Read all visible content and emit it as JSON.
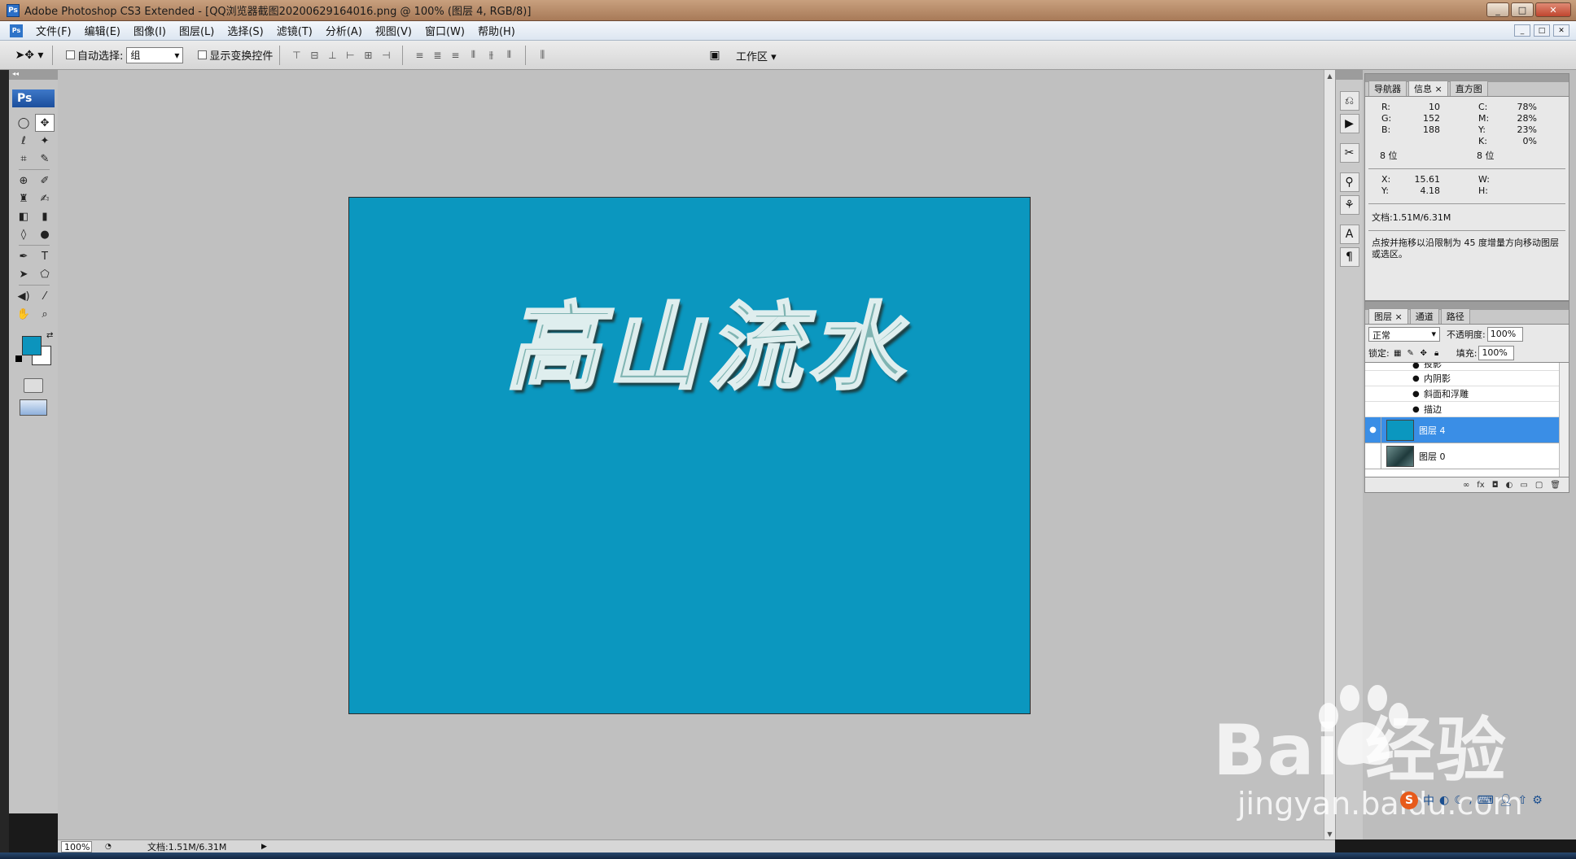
{
  "window": {
    "title": "Adobe Photoshop CS3 Extended - [QQ浏览器截图20200629164016.png @ 100% (图层 4, RGB/8)]",
    "app_icon": "Ps",
    "buttons": [
      "_",
      "□",
      "✕"
    ]
  },
  "menu": {
    "items": [
      "文件(F)",
      "编辑(E)",
      "图像(I)",
      "图层(L)",
      "选择(S)",
      "滤镜(T)",
      "分析(A)",
      "视图(V)",
      "窗口(W)",
      "帮助(H)"
    ],
    "mdi_buttons": [
      "_",
      "□",
      "✕"
    ]
  },
  "options": {
    "auto_select_label": "自动选择:",
    "auto_select_value": "组",
    "show_transform_label": "显示变换控件",
    "workspace_label": "工作区 ▾"
  },
  "toolbox": {
    "logo": "Ps",
    "tools": [
      {
        "icon": "marquee-icon",
        "glyph": "◯"
      },
      {
        "icon": "move-icon",
        "glyph": "✥"
      },
      {
        "icon": "lasso-icon",
        "glyph": "ℓ"
      },
      {
        "icon": "magic-wand-icon",
        "glyph": "✦"
      },
      {
        "icon": "crop-icon",
        "glyph": "⌗"
      },
      {
        "icon": "slice-icon",
        "glyph": "✎"
      },
      {
        "icon": "healing-brush-icon",
        "glyph": "⊕"
      },
      {
        "icon": "brush-icon",
        "glyph": "✐"
      },
      {
        "icon": "clone-stamp-icon",
        "glyph": "♜"
      },
      {
        "icon": "history-brush-icon",
        "glyph": "✍"
      },
      {
        "icon": "eraser-icon",
        "glyph": "◧"
      },
      {
        "icon": "gradient-icon",
        "glyph": "▮"
      },
      {
        "icon": "blur-icon",
        "glyph": "◊"
      },
      {
        "icon": "dodge-icon",
        "glyph": "●"
      },
      {
        "icon": "pen-icon",
        "glyph": "✒"
      },
      {
        "icon": "type-icon",
        "glyph": "T"
      },
      {
        "icon": "path-selection-icon",
        "glyph": "➤"
      },
      {
        "icon": "shape-icon",
        "glyph": "⬠"
      },
      {
        "icon": "audio-annotation-icon",
        "glyph": "◀)"
      },
      {
        "icon": "eyedropper-icon",
        "glyph": "⁄"
      },
      {
        "icon": "hand-icon",
        "glyph": "✋"
      },
      {
        "icon": "zoom-icon",
        "glyph": "⌕"
      }
    ]
  },
  "canvas": {
    "headline": "高山流水",
    "fill_color": "#0b97bf"
  },
  "status": {
    "zoom": "100%",
    "doc": "文档:1.51M/6.31M",
    "play": "▶"
  },
  "info_panel": {
    "tabs": [
      "导航器",
      "信息 ×",
      "直方图"
    ],
    "rgb": [
      {
        "k": "R:",
        "v": "10"
      },
      {
        "k": "G:",
        "v": "152"
      },
      {
        "k": "B:",
        "v": "188"
      }
    ],
    "cmyk": [
      {
        "k": "C:",
        "v": "78%"
      },
      {
        "k": "M:",
        "v": "28%"
      },
      {
        "k": "Y:",
        "v": "23%"
      },
      {
        "k": "K:",
        "v": "0%"
      }
    ],
    "bit_left": "8 位",
    "bit_right": "8 位",
    "xy": [
      {
        "k": "X:",
        "v": "15.61"
      },
      {
        "k": "Y:",
        "v": "4.18"
      }
    ],
    "wh": [
      {
        "k": "W:",
        "v": ""
      },
      {
        "k": "H:",
        "v": ""
      }
    ],
    "doc": "文档:1.51M/6.31M",
    "hint": "点按并拖移以沿限制为 45 度增量方向移动图层或选区。"
  },
  "layers_panel": {
    "tabs": [
      "图层 ×",
      "通道",
      "路径"
    ],
    "blend_mode": "正常",
    "opacity_label": "不透明度:",
    "opacity": "100%",
    "lock_label": "锁定:",
    "fill_label": "填充:",
    "fill": "100%",
    "effects": [
      "投影",
      "内阴影",
      "斜面和浮雕",
      "描边"
    ],
    "layers": [
      {
        "name": "图层 4",
        "selected": true,
        "visible": true,
        "thumb": "#0b97bf"
      },
      {
        "name": "图层 0",
        "selected": false,
        "visible": false,
        "thumb": "#2f5556"
      }
    ],
    "footer_icons": [
      "link-icon",
      "fx-icon",
      "mask-icon",
      "adjustment-icon",
      "group-icon",
      "new-layer-icon",
      "trash-icon"
    ]
  },
  "watermark": {
    "main": "Bai  经验",
    "sub": "jingyan.baidu.com"
  }
}
